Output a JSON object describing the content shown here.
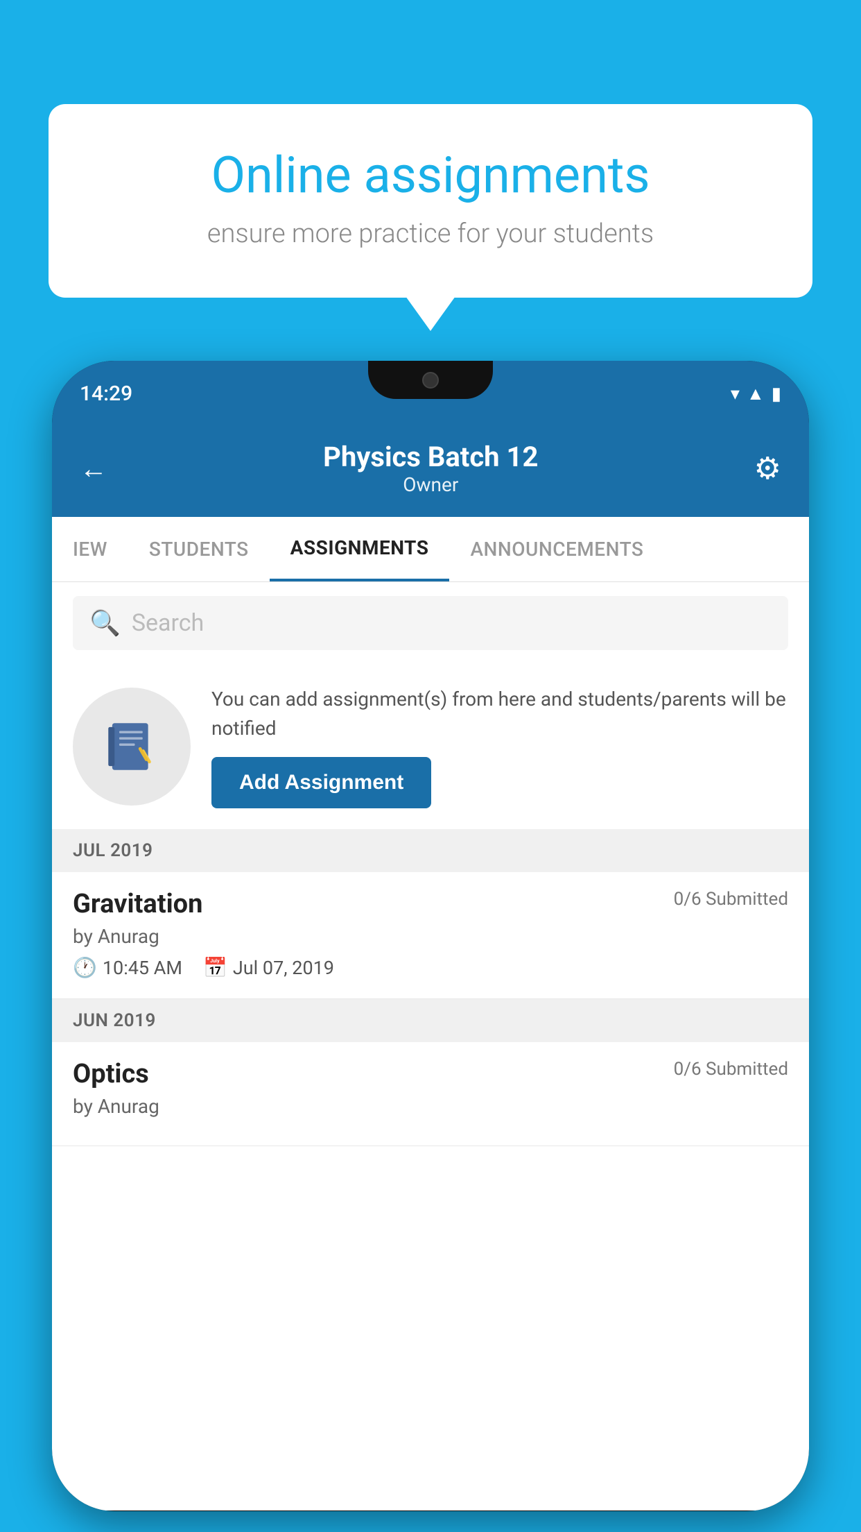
{
  "background_color": "#1ab0e8",
  "speech_bubble": {
    "title": "Online assignments",
    "subtitle": "ensure more practice for your students"
  },
  "phone": {
    "status_bar": {
      "time": "14:29",
      "icons": [
        "wifi",
        "signal",
        "battery"
      ]
    },
    "header": {
      "title": "Physics Batch 12",
      "subtitle": "Owner",
      "back_label": "←",
      "gear_label": "⚙"
    },
    "tabs": [
      {
        "label": "IEW",
        "active": false
      },
      {
        "label": "STUDENTS",
        "active": false
      },
      {
        "label": "ASSIGNMENTS",
        "active": true
      },
      {
        "label": "ANNOUNCEMENTS",
        "active": false
      }
    ],
    "search": {
      "placeholder": "Search"
    },
    "promo_card": {
      "description": "You can add assignment(s) from here and students/parents will be notified",
      "button_label": "Add Assignment"
    },
    "sections": [
      {
        "month": "JUL 2019",
        "assignments": [
          {
            "name": "Gravitation",
            "submitted": "0/6 Submitted",
            "by": "by Anurag",
            "time": "10:45 AM",
            "date": "Jul 07, 2019"
          }
        ]
      },
      {
        "month": "JUN 2019",
        "assignments": [
          {
            "name": "Optics",
            "submitted": "0/6 Submitted",
            "by": "by Anurag",
            "time": "",
            "date": ""
          }
        ]
      }
    ]
  }
}
